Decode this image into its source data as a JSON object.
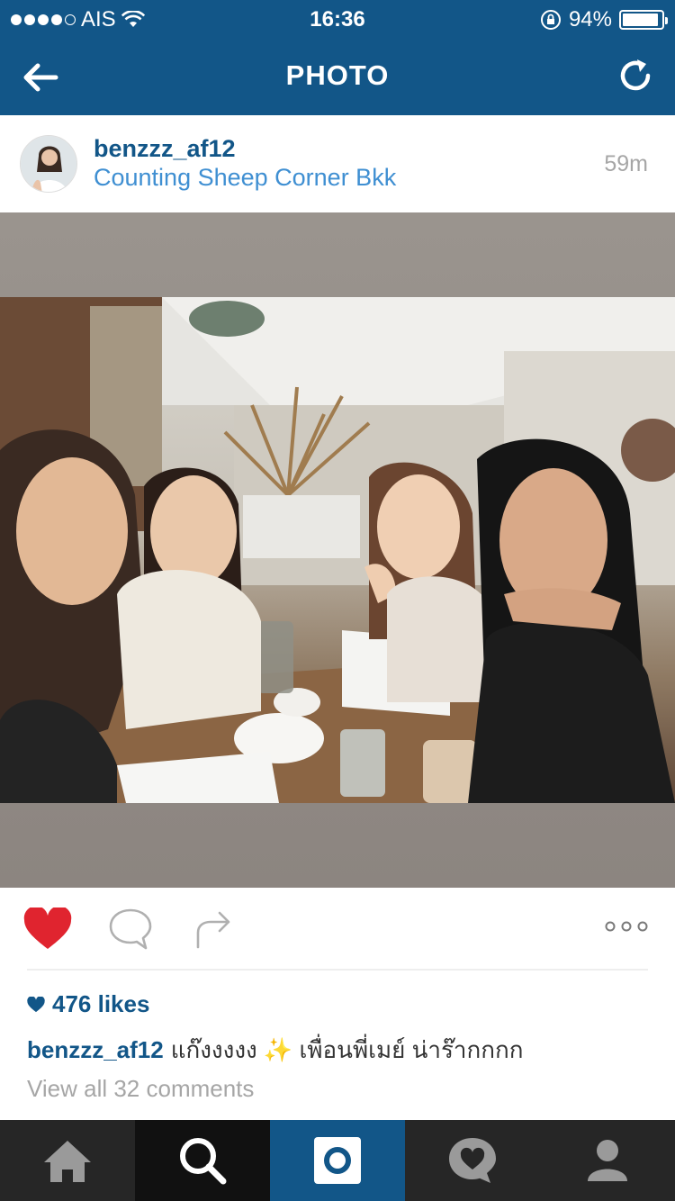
{
  "status_bar": {
    "carrier": "AIS",
    "time": "16:36",
    "battery_percent": "94%",
    "battery_level": 0.94
  },
  "nav": {
    "title": "PHOTO",
    "back_icon": "back-arrow-icon",
    "refresh_icon": "refresh-icon"
  },
  "post": {
    "username": "benzzz_af12",
    "location": "Counting Sheep Corner Bkk",
    "time_ago": "59m",
    "likes": "476 likes",
    "caption_user": "benzzz_af12",
    "caption_text": "แก๊งงงงง ✨ เพื่อนพี่เมย์ น่าร๊ากกกก",
    "view_comments": "View all 32 comments"
  },
  "colors": {
    "brand": "#125688",
    "link": "#3f8fd2",
    "like": "#e0242f",
    "muted": "#a6a6a6"
  },
  "tabs": [
    {
      "icon": "home-icon"
    },
    {
      "icon": "search-icon"
    },
    {
      "icon": "camera-icon"
    },
    {
      "icon": "activity-icon"
    },
    {
      "icon": "profile-icon"
    }
  ]
}
